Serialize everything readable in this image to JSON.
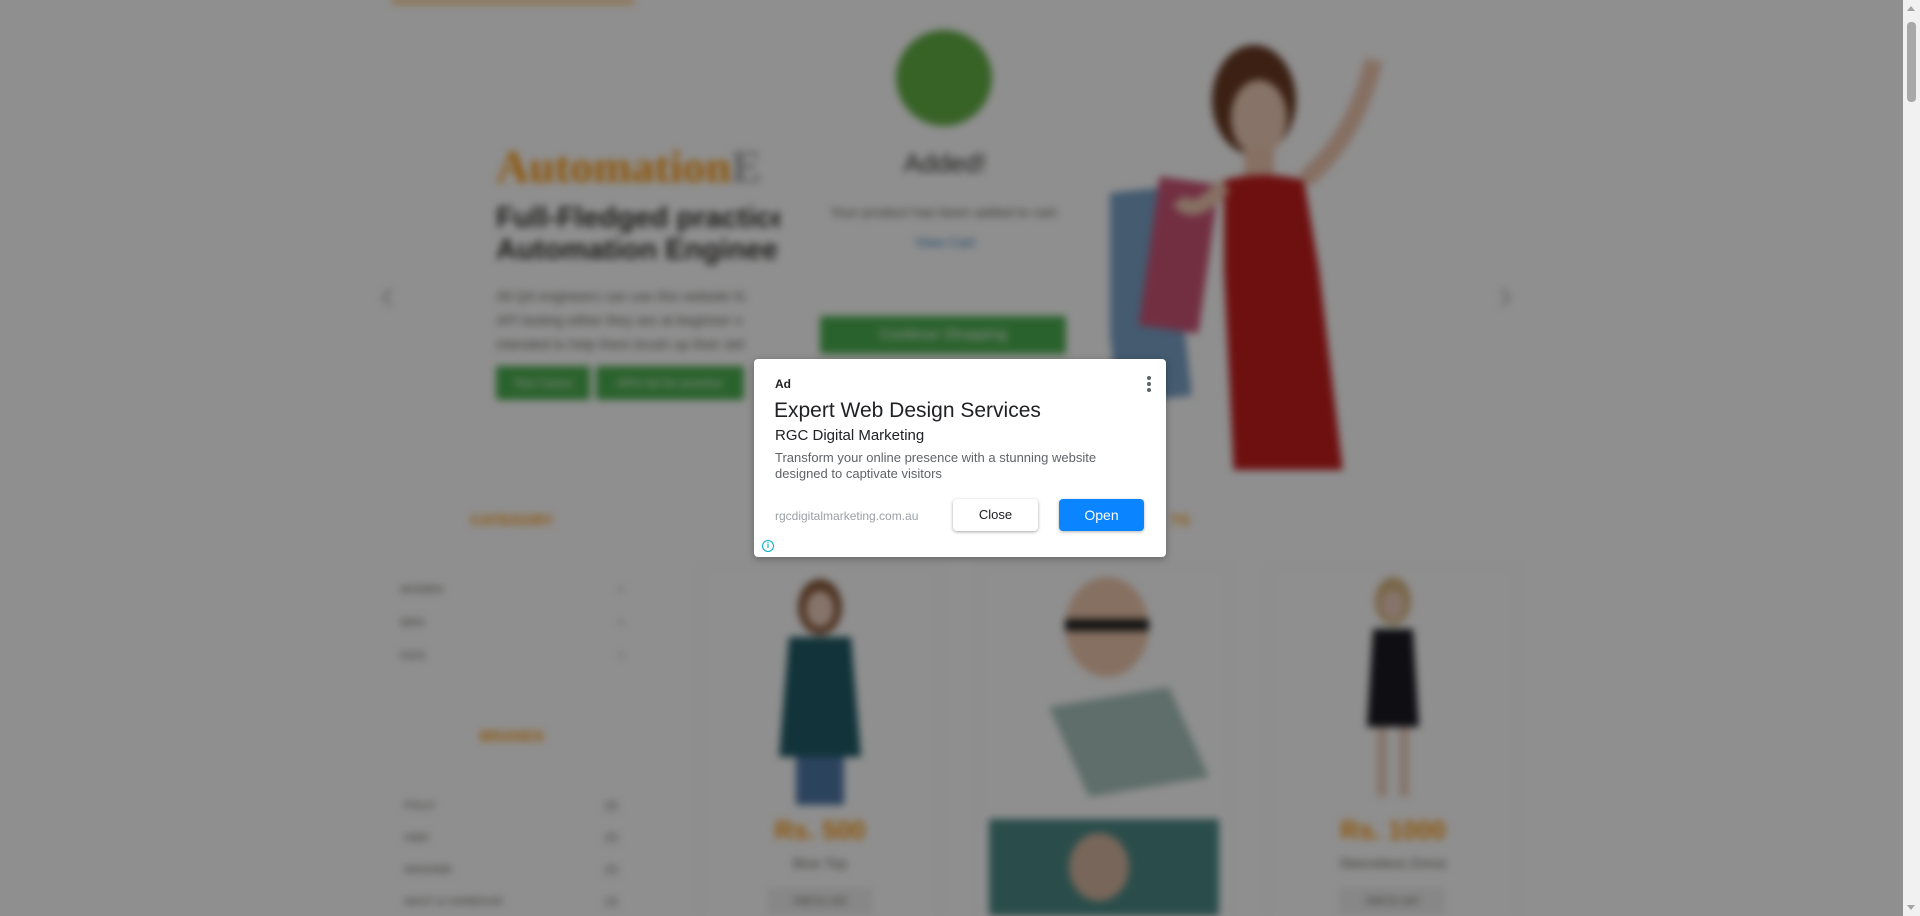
{
  "background": {
    "brand_primary": "Automation",
    "brand_secondary": "E",
    "hero_heading_line1": "Full-Fledged practice",
    "hero_heading_line2": "Automation Engineer",
    "hero_paragraph_line1": "All QA engineers can use this website fo",
    "hero_paragraph_line2": "API testing either they are at beginner o",
    "hero_paragraph_line3": "intended to help them brush up their skil",
    "test_cases_label": "Test Cases",
    "apis_list_label": "APIs list for practice",
    "modal": {
      "title": "Added!",
      "message": "Your product has been added to cart.",
      "link": "View Cart",
      "button": "Continue Shopping"
    },
    "category_heading": "CATEGORY",
    "categories": [
      {
        "name": "WOMEN",
        "count": "+"
      },
      {
        "name": "MEN",
        "count": "+"
      },
      {
        "name": "KIDS",
        "count": "+"
      }
    ],
    "brands_heading": "BRANDS",
    "brands": [
      {
        "name": "POLO",
        "count": "(6)"
      },
      {
        "name": "H&M",
        "count": "(5)"
      },
      {
        "name": "MADAME",
        "count": "(5)"
      },
      {
        "name": "MAST & HARBOUR",
        "count": "(3)"
      }
    ],
    "features_heading_fragment": "TS",
    "products": [
      {
        "price": "Rs. 500",
        "name": "Blue Top",
        "cta": "Add to cart"
      },
      {
        "price": "Rs. 1000",
        "name": "Sleeveless Dress",
        "cta": "Add to cart"
      }
    ]
  },
  "ad": {
    "label": "Ad",
    "headline": "Expert Web Design Services",
    "advertiser": "RGC Digital Marketing",
    "body": "Transform your online presence with a stunning website designed to captivate visitors",
    "url": "rgcdigitalmarketing.com.au",
    "close_label": "Close",
    "open_label": "Open",
    "info_icon": "i",
    "open_color": "#0a84ff"
  },
  "colors": {
    "accent_orange": "#FE980F",
    "green": "#4caf50"
  }
}
